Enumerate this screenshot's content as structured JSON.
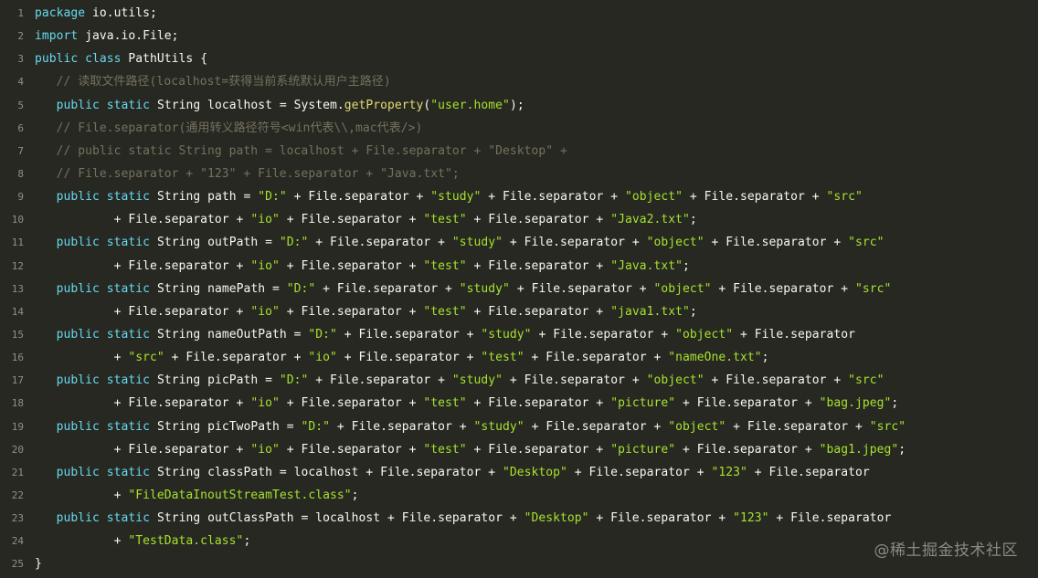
{
  "code": {
    "lines": [
      {
        "n": "1",
        "tokens": [
          {
            "t": "package",
            "c": "kw"
          },
          {
            "t": " io.utils;",
            "c": "pl"
          }
        ]
      },
      {
        "n": "2",
        "tokens": [
          {
            "t": "import",
            "c": "kw"
          },
          {
            "t": " java.io.File;",
            "c": "pl"
          }
        ]
      },
      {
        "n": "3",
        "tokens": [
          {
            "t": "public",
            "c": "kw"
          },
          {
            "t": " ",
            "c": "pl"
          },
          {
            "t": "class",
            "c": "kw"
          },
          {
            "t": " PathUtils {",
            "c": "pl"
          }
        ]
      },
      {
        "n": "4",
        "tokens": [
          {
            "t": "   // 读取文件路径(localhost=获得当前系统默认用户主路径)",
            "c": "cm"
          }
        ]
      },
      {
        "n": "5",
        "tokens": [
          {
            "t": "   ",
            "c": "pl"
          },
          {
            "t": "public",
            "c": "kw"
          },
          {
            "t": " ",
            "c": "pl"
          },
          {
            "t": "static",
            "c": "kw"
          },
          {
            "t": " String localhost = System.",
            "c": "pl"
          },
          {
            "t": "getProperty",
            "c": "fn"
          },
          {
            "t": "(",
            "c": "pl"
          },
          {
            "t": "\"user.home\"",
            "c": "str"
          },
          {
            "t": ");",
            "c": "pl"
          }
        ]
      },
      {
        "n": "6",
        "tokens": [
          {
            "t": "   // File.separator(通用转义路径符号<win代表\\\\,mac代表/>)",
            "c": "cm"
          }
        ]
      },
      {
        "n": "7",
        "tokens": [
          {
            "t": "   // public static String path = localhost + File.separator + \"Desktop\" +",
            "c": "cm"
          }
        ]
      },
      {
        "n": "8",
        "tokens": [
          {
            "t": "   // File.separator + \"123\" + File.separator + \"Java.txt\";",
            "c": "cm"
          }
        ]
      },
      {
        "n": "9",
        "tokens": [
          {
            "t": "   ",
            "c": "pl"
          },
          {
            "t": "public",
            "c": "kw"
          },
          {
            "t": " ",
            "c": "pl"
          },
          {
            "t": "static",
            "c": "kw"
          },
          {
            "t": " String path = ",
            "c": "pl"
          },
          {
            "t": "\"D:\"",
            "c": "str"
          },
          {
            "t": " + File.separator + ",
            "c": "pl"
          },
          {
            "t": "\"study\"",
            "c": "str"
          },
          {
            "t": " + File.separator + ",
            "c": "pl"
          },
          {
            "t": "\"object\"",
            "c": "str"
          },
          {
            "t": " + File.separator + ",
            "c": "pl"
          },
          {
            "t": "\"src\"",
            "c": "str"
          }
        ]
      },
      {
        "n": "10",
        "tokens": [
          {
            "t": "           + File.separator + ",
            "c": "pl"
          },
          {
            "t": "\"io\"",
            "c": "str"
          },
          {
            "t": " + File.separator + ",
            "c": "pl"
          },
          {
            "t": "\"test\"",
            "c": "str"
          },
          {
            "t": " + File.separator + ",
            "c": "pl"
          },
          {
            "t": "\"Java2.txt\"",
            "c": "str"
          },
          {
            "t": ";",
            "c": "pl"
          }
        ]
      },
      {
        "n": "11",
        "tokens": [
          {
            "t": "   ",
            "c": "pl"
          },
          {
            "t": "public",
            "c": "kw"
          },
          {
            "t": " ",
            "c": "pl"
          },
          {
            "t": "static",
            "c": "kw"
          },
          {
            "t": " String outPath = ",
            "c": "pl"
          },
          {
            "t": "\"D:\"",
            "c": "str"
          },
          {
            "t": " + File.separator + ",
            "c": "pl"
          },
          {
            "t": "\"study\"",
            "c": "str"
          },
          {
            "t": " + File.separator + ",
            "c": "pl"
          },
          {
            "t": "\"object\"",
            "c": "str"
          },
          {
            "t": " + File.separator + ",
            "c": "pl"
          },
          {
            "t": "\"src\"",
            "c": "str"
          }
        ]
      },
      {
        "n": "12",
        "tokens": [
          {
            "t": "           + File.separator + ",
            "c": "pl"
          },
          {
            "t": "\"io\"",
            "c": "str"
          },
          {
            "t": " + File.separator + ",
            "c": "pl"
          },
          {
            "t": "\"test\"",
            "c": "str"
          },
          {
            "t": " + File.separator + ",
            "c": "pl"
          },
          {
            "t": "\"Java.txt\"",
            "c": "str"
          },
          {
            "t": ";",
            "c": "pl"
          }
        ]
      },
      {
        "n": "13",
        "tokens": [
          {
            "t": "   ",
            "c": "pl"
          },
          {
            "t": "public",
            "c": "kw"
          },
          {
            "t": " ",
            "c": "pl"
          },
          {
            "t": "static",
            "c": "kw"
          },
          {
            "t": " String namePath = ",
            "c": "pl"
          },
          {
            "t": "\"D:\"",
            "c": "str"
          },
          {
            "t": " + File.separator + ",
            "c": "pl"
          },
          {
            "t": "\"study\"",
            "c": "str"
          },
          {
            "t": " + File.separator + ",
            "c": "pl"
          },
          {
            "t": "\"object\"",
            "c": "str"
          },
          {
            "t": " + File.separator + ",
            "c": "pl"
          },
          {
            "t": "\"src\"",
            "c": "str"
          }
        ]
      },
      {
        "n": "14",
        "tokens": [
          {
            "t": "           + File.separator + ",
            "c": "pl"
          },
          {
            "t": "\"io\"",
            "c": "str"
          },
          {
            "t": " + File.separator + ",
            "c": "pl"
          },
          {
            "t": "\"test\"",
            "c": "str"
          },
          {
            "t": " + File.separator + ",
            "c": "pl"
          },
          {
            "t": "\"java1.txt\"",
            "c": "str"
          },
          {
            "t": ";",
            "c": "pl"
          }
        ]
      },
      {
        "n": "15",
        "tokens": [
          {
            "t": "   ",
            "c": "pl"
          },
          {
            "t": "public",
            "c": "kw"
          },
          {
            "t": " ",
            "c": "pl"
          },
          {
            "t": "static",
            "c": "kw"
          },
          {
            "t": " String nameOutPath = ",
            "c": "pl"
          },
          {
            "t": "\"D:\"",
            "c": "str"
          },
          {
            "t": " + File.separator + ",
            "c": "pl"
          },
          {
            "t": "\"study\"",
            "c": "str"
          },
          {
            "t": " + File.separator + ",
            "c": "pl"
          },
          {
            "t": "\"object\"",
            "c": "str"
          },
          {
            "t": " + File.separator",
            "c": "pl"
          }
        ]
      },
      {
        "n": "16",
        "tokens": [
          {
            "t": "           + ",
            "c": "pl"
          },
          {
            "t": "\"src\"",
            "c": "str"
          },
          {
            "t": " + File.separator + ",
            "c": "pl"
          },
          {
            "t": "\"io\"",
            "c": "str"
          },
          {
            "t": " + File.separator + ",
            "c": "pl"
          },
          {
            "t": "\"test\"",
            "c": "str"
          },
          {
            "t": " + File.separator + ",
            "c": "pl"
          },
          {
            "t": "\"nameOne.txt\"",
            "c": "str"
          },
          {
            "t": ";",
            "c": "pl"
          }
        ]
      },
      {
        "n": "17",
        "tokens": [
          {
            "t": "   ",
            "c": "pl"
          },
          {
            "t": "public",
            "c": "kw"
          },
          {
            "t": " ",
            "c": "pl"
          },
          {
            "t": "static",
            "c": "kw"
          },
          {
            "t": " String picPath = ",
            "c": "pl"
          },
          {
            "t": "\"D:\"",
            "c": "str"
          },
          {
            "t": " + File.separator + ",
            "c": "pl"
          },
          {
            "t": "\"study\"",
            "c": "str"
          },
          {
            "t": " + File.separator + ",
            "c": "pl"
          },
          {
            "t": "\"object\"",
            "c": "str"
          },
          {
            "t": " + File.separator + ",
            "c": "pl"
          },
          {
            "t": "\"src\"",
            "c": "str"
          }
        ]
      },
      {
        "n": "18",
        "tokens": [
          {
            "t": "           + File.separator + ",
            "c": "pl"
          },
          {
            "t": "\"io\"",
            "c": "str"
          },
          {
            "t": " + File.separator + ",
            "c": "pl"
          },
          {
            "t": "\"test\"",
            "c": "str"
          },
          {
            "t": " + File.separator + ",
            "c": "pl"
          },
          {
            "t": "\"picture\"",
            "c": "str"
          },
          {
            "t": " + File.separator + ",
            "c": "pl"
          },
          {
            "t": "\"bag.jpeg\"",
            "c": "str"
          },
          {
            "t": ";",
            "c": "pl"
          }
        ]
      },
      {
        "n": "19",
        "tokens": [
          {
            "t": "   ",
            "c": "pl"
          },
          {
            "t": "public",
            "c": "kw"
          },
          {
            "t": " ",
            "c": "pl"
          },
          {
            "t": "static",
            "c": "kw"
          },
          {
            "t": " String picTwoPath = ",
            "c": "pl"
          },
          {
            "t": "\"D:\"",
            "c": "str"
          },
          {
            "t": " + File.separator + ",
            "c": "pl"
          },
          {
            "t": "\"study\"",
            "c": "str"
          },
          {
            "t": " + File.separator + ",
            "c": "pl"
          },
          {
            "t": "\"object\"",
            "c": "str"
          },
          {
            "t": " + File.separator + ",
            "c": "pl"
          },
          {
            "t": "\"src\"",
            "c": "str"
          }
        ]
      },
      {
        "n": "20",
        "tokens": [
          {
            "t": "           + File.separator + ",
            "c": "pl"
          },
          {
            "t": "\"io\"",
            "c": "str"
          },
          {
            "t": " + File.separator + ",
            "c": "pl"
          },
          {
            "t": "\"test\"",
            "c": "str"
          },
          {
            "t": " + File.separator + ",
            "c": "pl"
          },
          {
            "t": "\"picture\"",
            "c": "str"
          },
          {
            "t": " + File.separator + ",
            "c": "pl"
          },
          {
            "t": "\"bag1.jpeg\"",
            "c": "str"
          },
          {
            "t": ";",
            "c": "pl"
          }
        ]
      },
      {
        "n": "21",
        "tokens": [
          {
            "t": "   ",
            "c": "pl"
          },
          {
            "t": "public",
            "c": "kw"
          },
          {
            "t": " ",
            "c": "pl"
          },
          {
            "t": "static",
            "c": "kw"
          },
          {
            "t": " String classPath = localhost + File.separator + ",
            "c": "pl"
          },
          {
            "t": "\"Desktop\"",
            "c": "str"
          },
          {
            "t": " + File.separator + ",
            "c": "pl"
          },
          {
            "t": "\"123\"",
            "c": "str"
          },
          {
            "t": " + File.separator",
            "c": "pl"
          }
        ]
      },
      {
        "n": "22",
        "tokens": [
          {
            "t": "           + ",
            "c": "pl"
          },
          {
            "t": "\"FileDataInoutStreamTest.class\"",
            "c": "str"
          },
          {
            "t": ";",
            "c": "pl"
          }
        ]
      },
      {
        "n": "23",
        "tokens": [
          {
            "t": "   ",
            "c": "pl"
          },
          {
            "t": "public",
            "c": "kw"
          },
          {
            "t": " ",
            "c": "pl"
          },
          {
            "t": "static",
            "c": "kw"
          },
          {
            "t": " String outClassPath = localhost + File.separator + ",
            "c": "pl"
          },
          {
            "t": "\"Desktop\"",
            "c": "str"
          },
          {
            "t": " + File.separator + ",
            "c": "pl"
          },
          {
            "t": "\"123\"",
            "c": "str"
          },
          {
            "t": " + File.separator",
            "c": "pl"
          }
        ]
      },
      {
        "n": "24",
        "tokens": [
          {
            "t": "           + ",
            "c": "pl"
          },
          {
            "t": "\"TestData.class\"",
            "c": "str"
          },
          {
            "t": ";",
            "c": "pl"
          }
        ]
      },
      {
        "n": "25",
        "tokens": [
          {
            "t": "}",
            "c": "pl"
          }
        ]
      }
    ]
  },
  "watermark": "@稀土掘金技术社区",
  "colors": {
    "background": "#272822",
    "text": "#f8f8f2",
    "keyword": "#66d9ef",
    "string": "#a6e22e",
    "function": "#e6db74",
    "comment": "#75715e",
    "gutter": "#8f908a"
  }
}
